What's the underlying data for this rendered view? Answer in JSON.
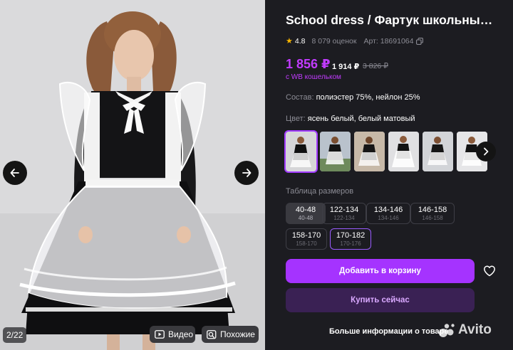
{
  "gallery": {
    "counter": "2/22",
    "video_label": "Видео",
    "similar_label": "Похожие",
    "prev_icon": "arrow-left-icon",
    "next_icon": "arrow-right-icon"
  },
  "product": {
    "title": "School dress / Фартук школьный ...",
    "rating": "4.8",
    "reviews": "8 079 оценок",
    "article": "Арт: 18691064",
    "price": "1 856 ₽",
    "price_regular": "1 914 ₽",
    "price_old": "3 826 ₽",
    "wallet_note": "с WB кошельком",
    "composition_label": "Состав:",
    "composition_value": "полиэстер 75%, нейлон 25%",
    "color_label": "Цвет:",
    "color_value": "ясень белый, белый матовый"
  },
  "thumbnails": [
    {
      "name": "thumb-1",
      "selected": true
    },
    {
      "name": "thumb-2",
      "selected": false
    },
    {
      "name": "thumb-3",
      "selected": false
    },
    {
      "name": "thumb-4",
      "selected": false
    },
    {
      "name": "thumb-5",
      "selected": false
    },
    {
      "name": "thumb-6",
      "selected": false
    }
  ],
  "sizes": {
    "label": "Таблица размеров",
    "items": [
      {
        "main": "40-48",
        "sub": "40-48"
      },
      {
        "main": "122-134",
        "sub": "122-134"
      },
      {
        "main": "134-146",
        "sub": "134-146"
      },
      {
        "main": "146-158",
        "sub": "146-158"
      },
      {
        "main": "158-170",
        "sub": "158-170"
      },
      {
        "main": "170-182",
        "sub": "170-176"
      }
    ]
  },
  "actions": {
    "add_to_cart": "Добавить в корзину",
    "buy_now": "Купить сейчас",
    "more_info": "Больше информации о товаре"
  },
  "watermark": "Avito",
  "colors": {
    "accent": "#a533ff",
    "price": "#c13bff",
    "background": "#1c1c21",
    "star": "#f7b500"
  }
}
